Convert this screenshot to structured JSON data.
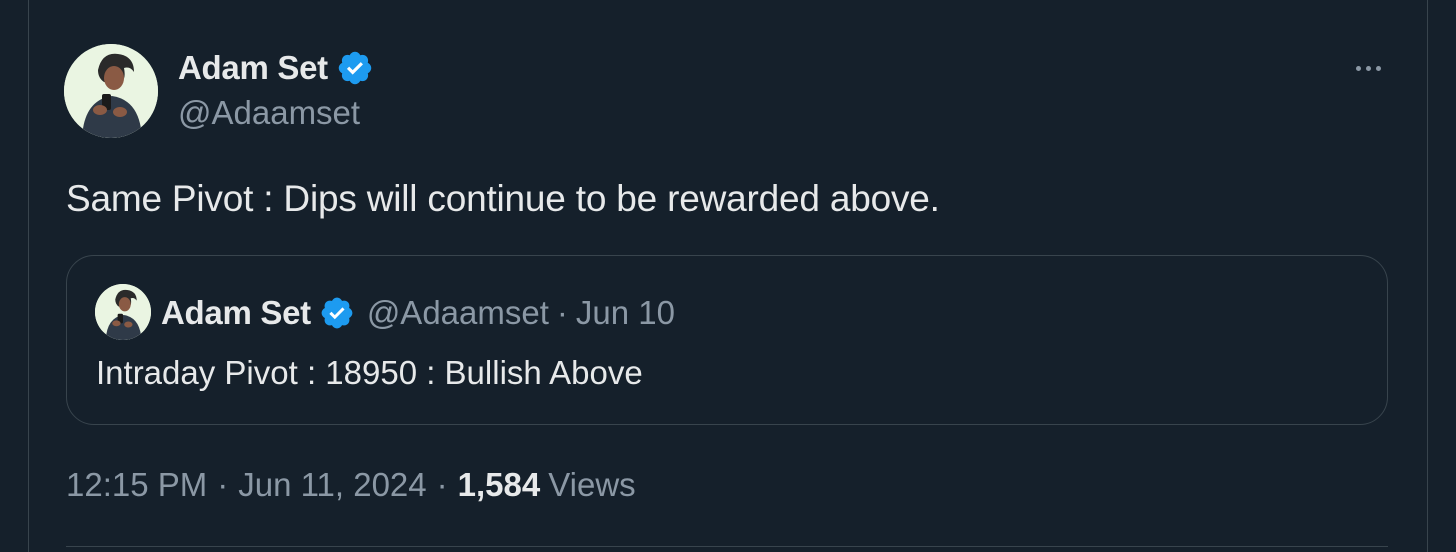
{
  "tweet": {
    "author": {
      "display_name": "Adam Set",
      "handle": "@Adaamset",
      "verified": true,
      "avatar_icon": "avatar-photo"
    },
    "text": "Same Pivot : Dips will continue to be rewarded above.",
    "more_icon": "more-dots-icon",
    "quoted": {
      "display_name": "Adam Set",
      "handle": "@Adaamset",
      "separator": "·",
      "date": "Jun 10",
      "text": "Intraday Pivot : 18950 : Bullish Above"
    },
    "meta": {
      "time": "12:15 PM",
      "separator": "·",
      "date": "Jun 11, 2024",
      "views_count": "1,584",
      "views_label": "Views"
    }
  },
  "colors": {
    "background": "#15202b",
    "text_primary": "#e7e9ea",
    "text_secondary": "#8b98a5",
    "border": "#38444d",
    "verified_blue": "#1d9bf0"
  }
}
